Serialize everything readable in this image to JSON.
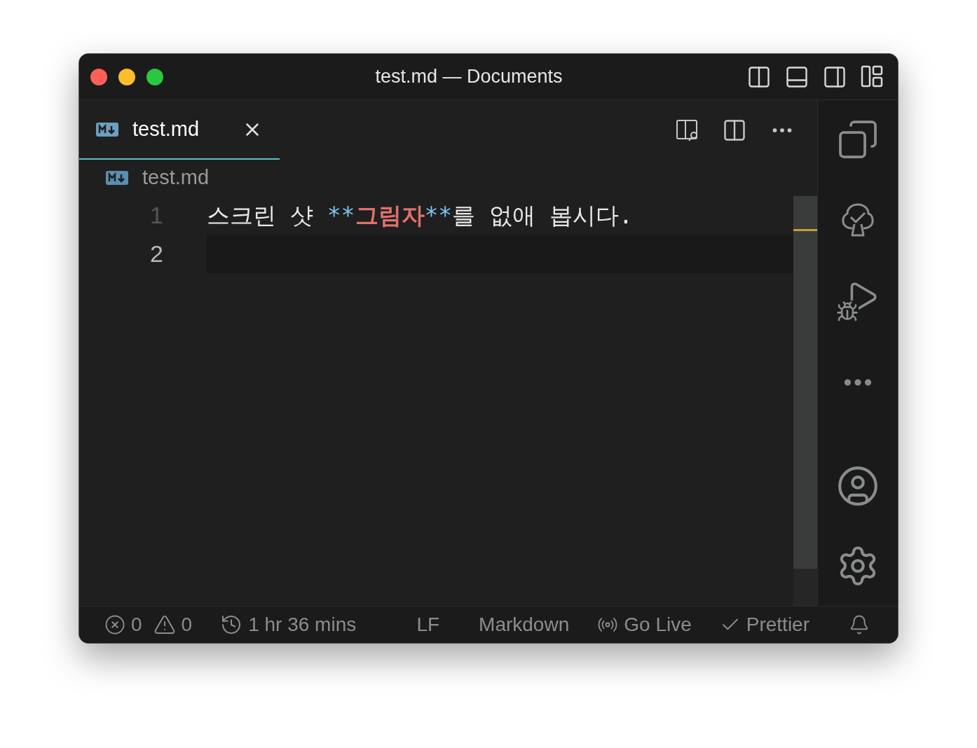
{
  "window": {
    "title": "test.md — Documents"
  },
  "tabs": [
    {
      "label": "test.md",
      "selected": true
    }
  ],
  "breadcrumb": "test.md",
  "editor": {
    "lines": [
      {
        "number": "1",
        "current": false,
        "tokens": [
          {
            "kind": "text",
            "text": "스크린 샷 "
          },
          {
            "kind": "marker",
            "text": "**"
          },
          {
            "kind": "bold",
            "text": "그림자"
          },
          {
            "kind": "marker",
            "text": "**"
          },
          {
            "kind": "text",
            "text": "를 없애 봅시다."
          }
        ]
      },
      {
        "number": "2",
        "current": true
      }
    ]
  },
  "status_bar": {
    "errors": "0",
    "warnings": "0",
    "session_time": "1 hr 36 mins",
    "line_ending": "LF",
    "language": "Markdown",
    "go_live": "Go Live",
    "formatter": "Prettier"
  }
}
